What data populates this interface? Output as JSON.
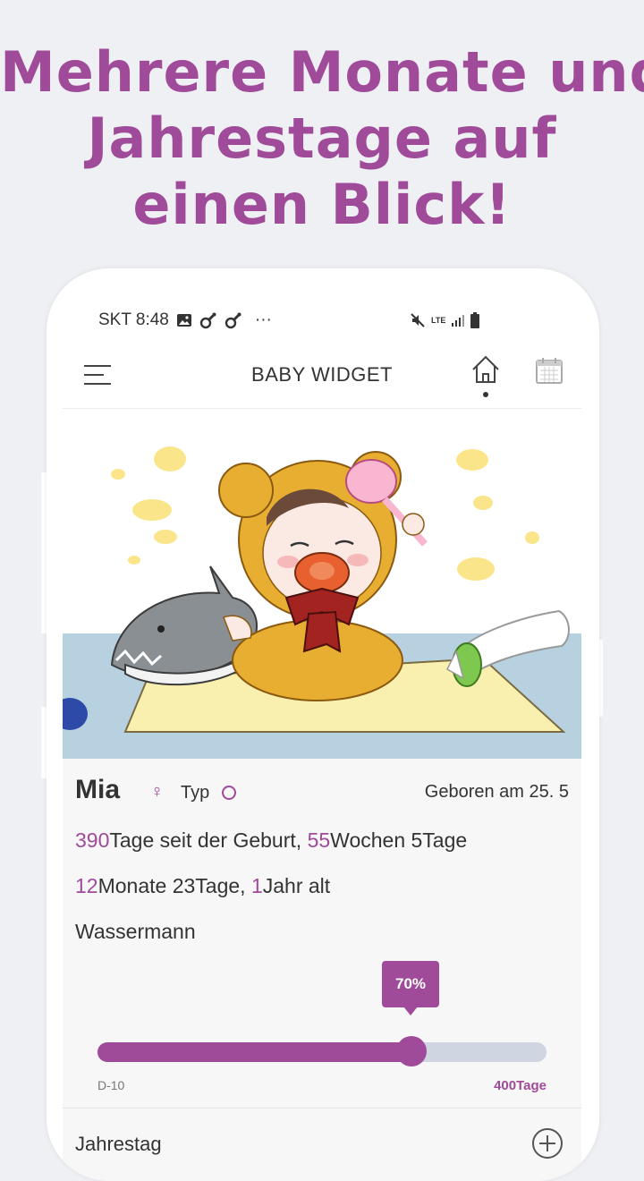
{
  "headline": {
    "line1": "Mehrere Monate und",
    "line2": "Jahrestage auf",
    "line3": "einen Blick!"
  },
  "status_bar": {
    "carrier_time": "SKT 8:48",
    "more": "···",
    "network": "LTE"
  },
  "app_bar": {
    "title": "BABY WIDGET",
    "icons": [
      "menu-icon",
      "home-icon",
      "calendar-icon"
    ]
  },
  "baby": {
    "name": "Mia",
    "gender_symbol": "♀",
    "type_label": "Typ",
    "born": "Geboren am 25. 5",
    "days_since_birth": "390",
    "days_since_birth_label": "Tage seit der Geburt, ",
    "weeks": "55",
    "weeks_label": "Wochen 5Tage",
    "months": "12",
    "months_label": "Monate 23Tage, ",
    "years": "1",
    "years_label": "Jahr alt",
    "zodiac": "Wassermann"
  },
  "progress": {
    "percent_label": "70%",
    "value": 0.7,
    "min_label": "D-10",
    "max_label": "400Tage"
  },
  "section": {
    "label": "Jahrestag"
  },
  "colors": {
    "accent": "#a04a9a",
    "track": "#cfd6e1",
    "background": "#eef0f4"
  }
}
